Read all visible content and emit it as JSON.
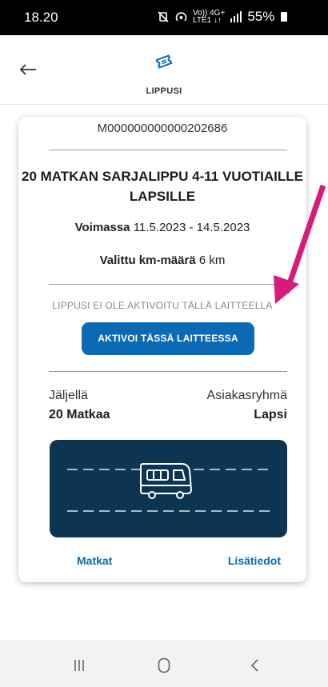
{
  "status": {
    "time": "18.20",
    "net_top": "Vo)) 4G+",
    "net_bottom": "LTE1 ↓↑",
    "battery": "55%"
  },
  "header": {
    "title": "LIPPUSI"
  },
  "ticket": {
    "id": "M000000000000202686",
    "title_line1": "20 MATKAN SARJALIPPU 4-11 VUOTIAILLE",
    "title_line2": "LAPSILLE",
    "valid_label": "Voimassa",
    "valid_value": "11.5.2023 - 14.5.2023",
    "km_label": "Valittu km-määrä",
    "km_value": "6 km",
    "notice": "LIPPUSI EI OLE AKTIVOITU TÄLLÄ LAITTEELLA",
    "activate_label": "AKTIVOI TÄSSÄ LAITTEESSA",
    "remaining_label": "Jäljellä",
    "remaining_value": "20 Matkaa",
    "group_label": "Asiakasryhmä",
    "group_value": "Lapsi",
    "trips_link": "Matkat",
    "details_link": "Lisätiedot"
  },
  "colors": {
    "accent": "#0b6ab3",
    "panel": "#0d3552",
    "annotation_arrow": "#d81b7a"
  },
  "icons": {
    "back": "arrow-left-icon",
    "ticket": "ticket-icon",
    "bus": "bus-icon",
    "recents": "recents-icon",
    "home": "home-icon",
    "nav_back": "chevron-left-icon"
  }
}
